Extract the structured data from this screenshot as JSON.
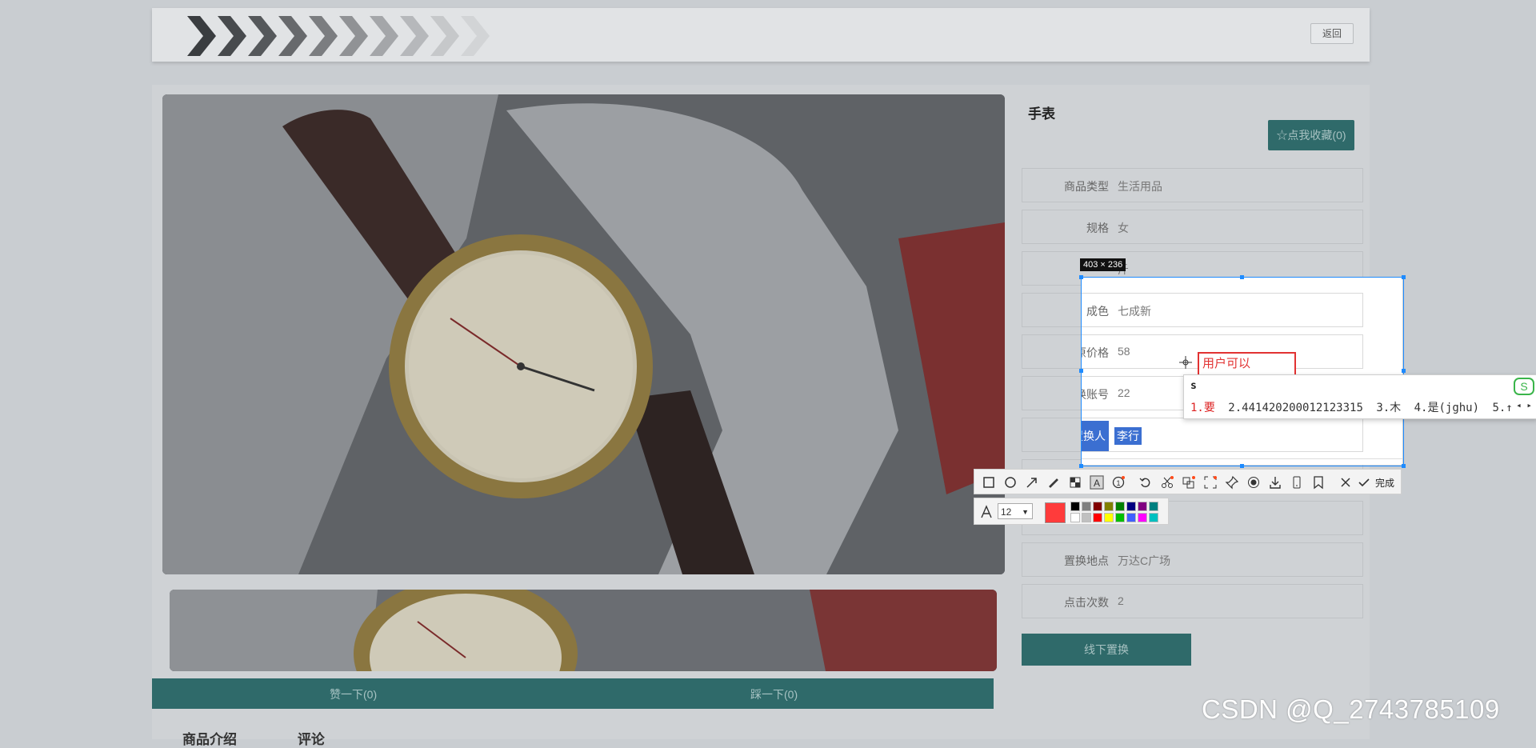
{
  "header": {
    "back_label": "返回"
  },
  "product": {
    "title": "手表",
    "favorite_label": "☆点我收藏(0)",
    "rows": [
      {
        "key": "商品类型",
        "value": "生活用品"
      },
      {
        "key": "规格",
        "value": "女"
      },
      {
        "key": "",
        "value": "斤"
      },
      {
        "key": "成色",
        "value": "七成新"
      },
      {
        "key": "原价格",
        "value": "58"
      },
      {
        "key": "置换账号",
        "value": "22"
      },
      {
        "key": "置换人",
        "value": "李行"
      },
      {
        "key": "置换地点",
        "value": "万达C广场"
      },
      {
        "key": "点击次数",
        "value": "2"
      }
    ],
    "offline_label": "线下置换"
  },
  "votes": {
    "up_label": "赞一下(0)",
    "down_label": "踩一下(0)"
  },
  "bottom_tabs": {
    "left": "商品介绍",
    "right": "评论"
  },
  "capture": {
    "dimensions": "403 × 236",
    "text_annotation": "用户可以",
    "toolbar_done": "完成",
    "font_size": "12",
    "current_color": "#ff3b3b",
    "palette": [
      "#000000",
      "#808080",
      "#800000",
      "#808000",
      "#008000",
      "#000080",
      "#800080",
      "#008080",
      "#ffffff",
      "#c0c0c0",
      "#ff0000",
      "#ffff00",
      "#00c000",
      "#4060ff",
      "#ff00ff",
      "#00c0c0"
    ]
  },
  "ime": {
    "input": "s",
    "candidates": [
      "1.要",
      "2.441420200012123315",
      "3.木",
      "4.是(jghu)",
      "5.↑"
    ]
  },
  "watermark": "CSDN @Q_2743785109"
}
